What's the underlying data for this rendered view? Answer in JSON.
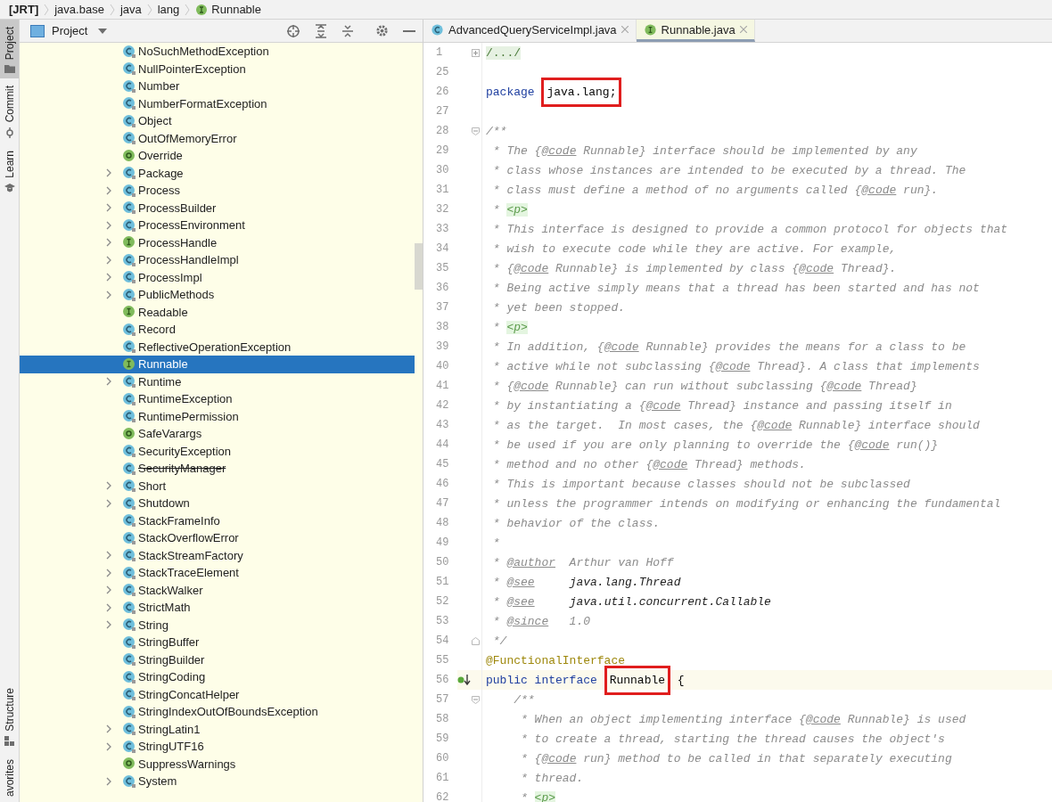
{
  "breadcrumb": [
    {
      "text": "[JRT]",
      "kind": "root"
    },
    {
      "text": "java.base",
      "kind": "package"
    },
    {
      "text": "java",
      "kind": "package"
    },
    {
      "text": "lang",
      "kind": "package"
    },
    {
      "text": "Runnable",
      "kind": "interface"
    }
  ],
  "tool_strip": {
    "top": [
      {
        "label": "Project",
        "kind": "folder",
        "selected": true
      },
      {
        "label": "Commit",
        "kind": "commit",
        "selected": false
      },
      {
        "label": "Learn",
        "kind": "learn",
        "selected": false
      }
    ],
    "bottom": [
      {
        "label": "Structure",
        "kind": "structure",
        "selected": false
      },
      {
        "label": "avorites",
        "kind": "none",
        "selected": false
      }
    ]
  },
  "project_panel": {
    "title": "Project",
    "items": [
      {
        "label": "NoSuchMethodException",
        "kind": "class",
        "expandable": false,
        "selected": false,
        "deprecated": false
      },
      {
        "label": "NullPointerException",
        "kind": "class",
        "expandable": false,
        "selected": false,
        "deprecated": false
      },
      {
        "label": "Number",
        "kind": "class",
        "expandable": false,
        "selected": false,
        "deprecated": false
      },
      {
        "label": "NumberFormatException",
        "kind": "class",
        "expandable": false,
        "selected": false,
        "deprecated": false
      },
      {
        "label": "Object",
        "kind": "class",
        "expandable": false,
        "selected": false,
        "deprecated": false
      },
      {
        "label": "OutOfMemoryError",
        "kind": "class",
        "expandable": false,
        "selected": false,
        "deprecated": false
      },
      {
        "label": "Override",
        "kind": "annotation",
        "expandable": false,
        "selected": false,
        "deprecated": false
      },
      {
        "label": "Package",
        "kind": "class",
        "expandable": true,
        "selected": false,
        "deprecated": false
      },
      {
        "label": "Process",
        "kind": "class",
        "expandable": true,
        "selected": false,
        "deprecated": false
      },
      {
        "label": "ProcessBuilder",
        "kind": "class",
        "expandable": true,
        "selected": false,
        "deprecated": false
      },
      {
        "label": "ProcessEnvironment",
        "kind": "class",
        "expandable": true,
        "selected": false,
        "deprecated": false
      },
      {
        "label": "ProcessHandle",
        "kind": "interface",
        "expandable": true,
        "selected": false,
        "deprecated": false
      },
      {
        "label": "ProcessHandleImpl",
        "kind": "class",
        "expandable": true,
        "selected": false,
        "deprecated": false
      },
      {
        "label": "ProcessImpl",
        "kind": "class",
        "expandable": true,
        "selected": false,
        "deprecated": false
      },
      {
        "label": "PublicMethods",
        "kind": "class",
        "expandable": true,
        "selected": false,
        "deprecated": false
      },
      {
        "label": "Readable",
        "kind": "interface",
        "expandable": false,
        "selected": false,
        "deprecated": false
      },
      {
        "label": "Record",
        "kind": "class",
        "expandable": false,
        "selected": false,
        "deprecated": false
      },
      {
        "label": "ReflectiveOperationException",
        "kind": "class",
        "expandable": false,
        "selected": false,
        "deprecated": false
      },
      {
        "label": "Runnable",
        "kind": "interface",
        "expandable": false,
        "selected": true,
        "deprecated": false
      },
      {
        "label": "Runtime",
        "kind": "class",
        "expandable": true,
        "selected": false,
        "deprecated": false
      },
      {
        "label": "RuntimeException",
        "kind": "class",
        "expandable": false,
        "selected": false,
        "deprecated": false
      },
      {
        "label": "RuntimePermission",
        "kind": "class",
        "expandable": false,
        "selected": false,
        "deprecated": false
      },
      {
        "label": "SafeVarargs",
        "kind": "annotation",
        "expandable": false,
        "selected": false,
        "deprecated": false
      },
      {
        "label": "SecurityException",
        "kind": "class",
        "expandable": false,
        "selected": false,
        "deprecated": false
      },
      {
        "label": "SecurityManager",
        "kind": "class",
        "expandable": false,
        "selected": false,
        "deprecated": true
      },
      {
        "label": "Short",
        "kind": "class",
        "expandable": true,
        "selected": false,
        "deprecated": false
      },
      {
        "label": "Shutdown",
        "kind": "class",
        "expandable": true,
        "selected": false,
        "deprecated": false
      },
      {
        "label": "StackFrameInfo",
        "kind": "class",
        "expandable": false,
        "selected": false,
        "deprecated": false
      },
      {
        "label": "StackOverflowError",
        "kind": "class",
        "expandable": false,
        "selected": false,
        "deprecated": false
      },
      {
        "label": "StackStreamFactory",
        "kind": "class",
        "expandable": true,
        "selected": false,
        "deprecated": false
      },
      {
        "label": "StackTraceElement",
        "kind": "class",
        "expandable": true,
        "selected": false,
        "deprecated": false
      },
      {
        "label": "StackWalker",
        "kind": "class",
        "expandable": true,
        "selected": false,
        "deprecated": false
      },
      {
        "label": "StrictMath",
        "kind": "class",
        "expandable": true,
        "selected": false,
        "deprecated": false
      },
      {
        "label": "String",
        "kind": "class",
        "expandable": true,
        "selected": false,
        "deprecated": false
      },
      {
        "label": "StringBuffer",
        "kind": "class",
        "expandable": false,
        "selected": false,
        "deprecated": false
      },
      {
        "label": "StringBuilder",
        "kind": "class",
        "expandable": false,
        "selected": false,
        "deprecated": false
      },
      {
        "label": "StringCoding",
        "kind": "class",
        "expandable": false,
        "selected": false,
        "deprecated": false
      },
      {
        "label": "StringConcatHelper",
        "kind": "class",
        "expandable": false,
        "selected": false,
        "deprecated": false
      },
      {
        "label": "StringIndexOutOfBoundsException",
        "kind": "class",
        "expandable": false,
        "selected": false,
        "deprecated": false
      },
      {
        "label": "StringLatin1",
        "kind": "class",
        "expandable": true,
        "selected": false,
        "deprecated": false
      },
      {
        "label": "StringUTF16",
        "kind": "class",
        "expandable": true,
        "selected": false,
        "deprecated": false
      },
      {
        "label": "SuppressWarnings",
        "kind": "annotation",
        "expandable": false,
        "selected": false,
        "deprecated": false
      },
      {
        "label": "System",
        "kind": "class",
        "expandable": true,
        "selected": false,
        "deprecated": false
      }
    ]
  },
  "editor": {
    "tabs": [
      {
        "label": "AdvancedQueryServiceImpl.java",
        "kind": "class",
        "selected": false
      },
      {
        "label": "Runnable.java",
        "kind": "interface",
        "selected": true
      }
    ],
    "lines": [
      {
        "number": "1",
        "folded": true,
        "segments": [
          {
            "kind": "fold",
            "text": "/.../"
          }
        ]
      },
      {
        "number": "25"
      },
      {
        "number": "26",
        "segments": [
          {
            "kind": "keyword",
            "text": "package "
          },
          {
            "kind": "plain",
            "text": "java.lang;",
            "marked": true
          }
        ]
      },
      {
        "number": "27"
      },
      {
        "number": "28",
        "fold_start": true,
        "segments": [
          {
            "kind": "comment",
            "text": "/**"
          }
        ]
      },
      {
        "number": "29",
        "segments": [
          {
            "kind": "comment",
            "text": " * The {"
          },
          {
            "kind": "doc",
            "text": "@code"
          },
          {
            "kind": "comment",
            "text": " Runnable} interface should be implemented by any"
          }
        ]
      },
      {
        "number": "30",
        "segments": [
          {
            "kind": "comment",
            "text": " * class whose instances are intended to be executed by a thread. The"
          }
        ]
      },
      {
        "number": "31",
        "segments": [
          {
            "kind": "comment",
            "text": " * class must define a method of no arguments called {"
          },
          {
            "kind": "doc",
            "text": "@code"
          },
          {
            "kind": "comment",
            "text": " run}."
          }
        ]
      },
      {
        "number": "32",
        "segments": [
          {
            "kind": "comment",
            "text": " * "
          },
          {
            "kind": "tag",
            "text": "<p>"
          }
        ]
      },
      {
        "number": "33",
        "segments": [
          {
            "kind": "comment",
            "text": " * This interface is designed to provide a common protocol for objects that"
          }
        ]
      },
      {
        "number": "34",
        "segments": [
          {
            "kind": "comment",
            "text": " * wish to execute code while they are active. For example,"
          }
        ]
      },
      {
        "number": "35",
        "segments": [
          {
            "kind": "comment",
            "text": " * {"
          },
          {
            "kind": "doc",
            "text": "@code"
          },
          {
            "kind": "comment",
            "text": " Runnable} is implemented by class {"
          },
          {
            "kind": "doc",
            "text": "@code"
          },
          {
            "kind": "comment",
            "text": " Thread}."
          }
        ]
      },
      {
        "number": "36",
        "segments": [
          {
            "kind": "comment",
            "text": " * Being active simply means that a thread has been started and has not"
          }
        ]
      },
      {
        "number": "37",
        "segments": [
          {
            "kind": "comment",
            "text": " * yet been stopped."
          }
        ]
      },
      {
        "number": "38",
        "segments": [
          {
            "kind": "comment",
            "text": " * "
          },
          {
            "kind": "tag",
            "text": "<p>"
          }
        ]
      },
      {
        "number": "39",
        "segments": [
          {
            "kind": "comment",
            "text": " * In addition, {"
          },
          {
            "kind": "doc",
            "text": "@code"
          },
          {
            "kind": "comment",
            "text": " Runnable} provides the means for a class to be"
          }
        ]
      },
      {
        "number": "40",
        "segments": [
          {
            "kind": "comment",
            "text": " * active while not subclassing {"
          },
          {
            "kind": "doc",
            "text": "@code"
          },
          {
            "kind": "comment",
            "text": " Thread}. A class that implements"
          }
        ]
      },
      {
        "number": "41",
        "segments": [
          {
            "kind": "comment",
            "text": " * {"
          },
          {
            "kind": "doc",
            "text": "@code"
          },
          {
            "kind": "comment",
            "text": " Runnable} can run without subclassing {"
          },
          {
            "kind": "doc",
            "text": "@code"
          },
          {
            "kind": "comment",
            "text": " Thread}"
          }
        ]
      },
      {
        "number": "42",
        "segments": [
          {
            "kind": "comment",
            "text": " * by instantiating a {"
          },
          {
            "kind": "doc",
            "text": "@code"
          },
          {
            "kind": "comment",
            "text": " Thread} instance and passing itself in"
          }
        ]
      },
      {
        "number": "43",
        "segments": [
          {
            "kind": "comment",
            "text": " * as the target.  In most cases, the {"
          },
          {
            "kind": "doc",
            "text": "@code"
          },
          {
            "kind": "comment",
            "text": " Runnable} interface should"
          }
        ]
      },
      {
        "number": "44",
        "segments": [
          {
            "kind": "comment",
            "text": " * be used if you are only planning to override the {"
          },
          {
            "kind": "doc",
            "text": "@code"
          },
          {
            "kind": "comment",
            "text": " run()}"
          }
        ]
      },
      {
        "number": "45",
        "segments": [
          {
            "kind": "comment",
            "text": " * method and no other {"
          },
          {
            "kind": "doc",
            "text": "@code"
          },
          {
            "kind": "comment",
            "text": " Thread} methods."
          }
        ]
      },
      {
        "number": "46",
        "segments": [
          {
            "kind": "comment",
            "text": " * This is important because classes should not be subclassed"
          }
        ]
      },
      {
        "number": "47",
        "segments": [
          {
            "kind": "comment",
            "text": " * unless the programmer intends on modifying or enhancing the fundamental"
          }
        ]
      },
      {
        "number": "48",
        "segments": [
          {
            "kind": "comment",
            "text": " * behavior of the class."
          }
        ]
      },
      {
        "number": "49",
        "segments": [
          {
            "kind": "comment",
            "text": " *"
          }
        ]
      },
      {
        "number": "50",
        "segments": [
          {
            "kind": "comment",
            "text": " * "
          },
          {
            "kind": "doc",
            "text": "@author"
          },
          {
            "kind": "comment",
            "text": "  Arthur van Hoff"
          }
        ]
      },
      {
        "number": "51",
        "segments": [
          {
            "kind": "comment",
            "text": " * "
          },
          {
            "kind": "doc",
            "text": "@see"
          },
          {
            "kind": "ref",
            "text": "     java.lang.Thread"
          }
        ]
      },
      {
        "number": "52",
        "segments": [
          {
            "kind": "comment",
            "text": " * "
          },
          {
            "kind": "doc",
            "text": "@see"
          },
          {
            "kind": "ref",
            "text": "     java.util.concurrent.Callable"
          }
        ]
      },
      {
        "number": "53",
        "segments": [
          {
            "kind": "comment",
            "text": " * "
          },
          {
            "kind": "doc",
            "text": "@since"
          },
          {
            "kind": "comment",
            "text": "   1.0"
          }
        ]
      },
      {
        "number": "54",
        "fold_end": true,
        "segments": [
          {
            "kind": "comment",
            "text": " */"
          }
        ]
      },
      {
        "number": "55",
        "segments": [
          {
            "kind": "annotation",
            "text": "@FunctionalInterface"
          }
        ]
      },
      {
        "number": "56",
        "current": true,
        "marker": true,
        "segments": [
          {
            "kind": "keyword",
            "text": "public interface "
          },
          {
            "kind": "plain",
            "text": "Runnable",
            "marked": true
          },
          {
            "kind": "plain",
            "text": " {"
          }
        ]
      },
      {
        "number": "57",
        "fold_start": true,
        "segments": [
          {
            "kind": "comment",
            "text": "    /**"
          }
        ]
      },
      {
        "number": "58",
        "segments": [
          {
            "kind": "comment",
            "text": "     * When an object implementing interface {"
          },
          {
            "kind": "doc",
            "text": "@code"
          },
          {
            "kind": "comment",
            "text": " Runnable} is used"
          }
        ]
      },
      {
        "number": "59",
        "segments": [
          {
            "kind": "comment",
            "text": "     * to create a thread, starting the thread causes the object's"
          }
        ]
      },
      {
        "number": "60",
        "segments": [
          {
            "kind": "comment",
            "text": "     * {"
          },
          {
            "kind": "doc",
            "text": "@code"
          },
          {
            "kind": "comment",
            "text": " run} method to be called in that separately executing"
          }
        ]
      },
      {
        "number": "61",
        "segments": [
          {
            "kind": "comment",
            "text": "     * thread."
          }
        ]
      },
      {
        "number": "62",
        "segments": [
          {
            "kind": "comment",
            "text": "     * "
          },
          {
            "kind": "tag",
            "text": "<p>"
          }
        ]
      }
    ]
  }
}
